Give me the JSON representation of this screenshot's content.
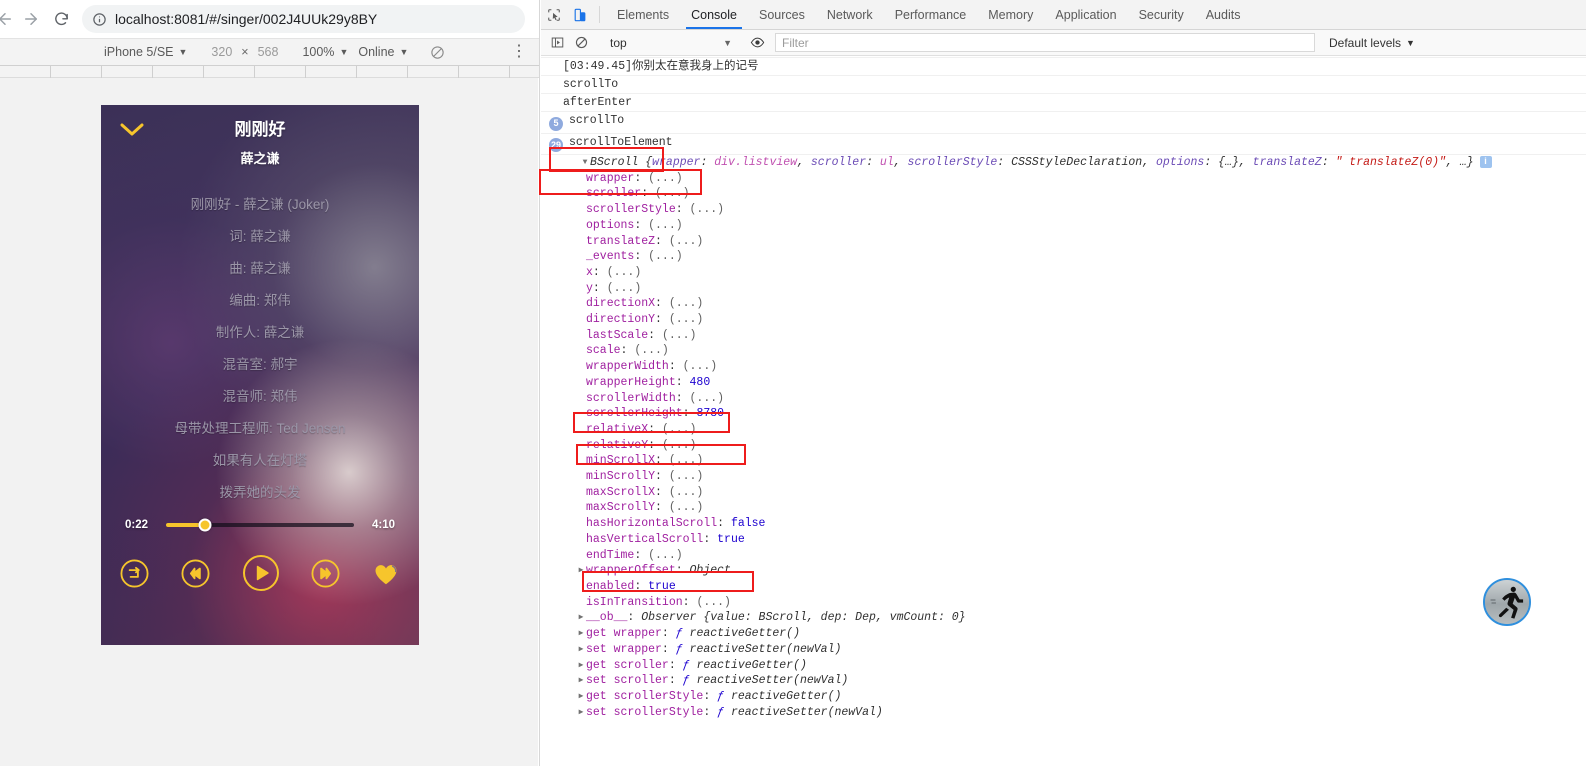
{
  "browser": {
    "back_icon": "back-arrow-icon",
    "forward_icon": "forward-arrow-icon",
    "reload_icon": "reload-icon",
    "site_info_icon": "info-circle-icon",
    "url": "localhost:8081/#/singer/002J4UUk29y8BY"
  },
  "device_toolbar": {
    "device": "iPhone 5/SE",
    "width": "320",
    "times": "×",
    "height": "568",
    "zoom": "100%",
    "throttling": "Online",
    "rotate_icon": "rotate-icon",
    "more_icon": "more-vertical-icon"
  },
  "player": {
    "back_icon": "chevron-down-icon",
    "title": "刚刚好",
    "artist": "薛之谦",
    "lyrics": [
      "刚刚好 - 薛之谦 (Joker)",
      "词: 薛之谦",
      "曲: 薛之谦",
      "编曲: 郑伟",
      "制作人: 薛之谦",
      "混音室: 郝宇",
      "混音师: 郑伟",
      "母带处理工程师: Ted Jensen",
      "如果有人在灯塔",
      "拨弄她的头发"
    ],
    "current_time": "0:22",
    "total_time": "4:10",
    "progress_percent": 21,
    "accent_color": "#f6c52c",
    "controls": [
      {
        "name": "loop-mode-button",
        "icon": "loop-sequence-icon"
      },
      {
        "name": "previous-button",
        "icon": "rewind-icon"
      },
      {
        "name": "play-pause-button",
        "icon": "play-icon"
      },
      {
        "name": "next-button",
        "icon": "fast-forward-icon"
      },
      {
        "name": "favorite-button",
        "icon": "heart-icon"
      }
    ]
  },
  "devtools": {
    "inspect_icon": "inspect-element-icon",
    "device_toggle_icon": "device-toolbar-icon",
    "tabs": [
      "Elements",
      "Console",
      "Sources",
      "Network",
      "Performance",
      "Memory",
      "Application",
      "Security",
      "Audits"
    ],
    "selected_tab": "Console",
    "filterbar": {
      "sidebar_icon": "console-sidebar-icon",
      "clear_icon": "clear-console-icon",
      "context": "top",
      "eye_icon": "live-expression-icon",
      "filter_placeholder": "Filter",
      "levels": "Default levels"
    },
    "messages": [
      {
        "text": "[03:49.45]你别太在意我身上的记号",
        "count": null
      },
      {
        "text": "scrollTo",
        "count": null
      },
      {
        "text": "afterEnter",
        "count": null
      },
      {
        "text": "scrollTo",
        "count": "5"
      },
      {
        "text": "scrollToElement",
        "count": "29"
      }
    ],
    "object_header": {
      "arrow": "▼",
      "ctor": "BScroll",
      "preview_parts": [
        {
          "key": "wrapper",
          "val": "div.listview",
          "style": "cls"
        },
        {
          "key": "scroller",
          "val": "ul",
          "style": "cls"
        },
        {
          "key": "scrollerStyle",
          "val": "CSSStyleDeclaration",
          "style": "typ"
        },
        {
          "key": "options",
          "val": "{…}",
          "style": "typ"
        },
        {
          "key": "translateZ",
          "val": "\" translateZ(0)\"",
          "style": "str"
        }
      ],
      "tail": ", …}",
      "info_badge": "i"
    },
    "properties": [
      {
        "key": "wrapper",
        "value": "(...)",
        "kind": "ellipsis"
      },
      {
        "key": "scroller",
        "value": "(...)",
        "kind": "ellipsis"
      },
      {
        "key": "scrollerStyle",
        "value": "(...)",
        "kind": "ellipsis"
      },
      {
        "key": "options",
        "value": "(...)",
        "kind": "ellipsis"
      },
      {
        "key": "translateZ",
        "value": "(...)",
        "kind": "ellipsis"
      },
      {
        "key": "_events",
        "value": "(...)",
        "kind": "ellipsis"
      },
      {
        "key": "x",
        "value": "(...)",
        "kind": "ellipsis"
      },
      {
        "key": "y",
        "value": "(...)",
        "kind": "ellipsis"
      },
      {
        "key": "directionX",
        "value": "(...)",
        "kind": "ellipsis"
      },
      {
        "key": "directionY",
        "value": "(...)",
        "kind": "ellipsis"
      },
      {
        "key": "lastScale",
        "value": "(...)",
        "kind": "ellipsis"
      },
      {
        "key": "scale",
        "value": "(...)",
        "kind": "ellipsis"
      },
      {
        "key": "wrapperWidth",
        "value": "(...)",
        "kind": "ellipsis"
      },
      {
        "key": "wrapperHeight",
        "value": "480",
        "kind": "number"
      },
      {
        "key": "scrollerWidth",
        "value": "(...)",
        "kind": "ellipsis"
      },
      {
        "key": "scrollerHeight",
        "value": "8780",
        "kind": "number"
      },
      {
        "key": "relativeX",
        "value": "(...)",
        "kind": "ellipsis"
      },
      {
        "key": "relativeY",
        "value": "(...)",
        "kind": "ellipsis"
      },
      {
        "key": "minScrollX",
        "value": "(...)",
        "kind": "ellipsis"
      },
      {
        "key": "minScrollY",
        "value": "(...)",
        "kind": "ellipsis"
      },
      {
        "key": "maxScrollX",
        "value": "(...)",
        "kind": "ellipsis"
      },
      {
        "key": "maxScrollY",
        "value": "(...)",
        "kind": "ellipsis"
      },
      {
        "key": "hasHorizontalScroll",
        "value": "false",
        "kind": "bool"
      },
      {
        "key": "hasVerticalScroll",
        "value": "true",
        "kind": "bool"
      },
      {
        "key": "endTime",
        "value": "(...)",
        "kind": "ellipsis"
      }
    ],
    "tail_rows": [
      {
        "arrow": "▶",
        "key": "wrapperOffset",
        "value": "Object",
        "kind": "plain"
      },
      {
        "arrow": "",
        "key": "enabled",
        "value": "true",
        "kind": "bool"
      },
      {
        "arrow": "",
        "key": "isInTransition",
        "value": "(...)",
        "kind": "ellipsis"
      },
      {
        "arrow": "▶",
        "key": "__ob__",
        "value": "Observer {value: BScroll, dep: Dep, vmCount: 0}",
        "kind": "observer"
      }
    ],
    "accessors": [
      {
        "arrow": "▶",
        "prefix": "get",
        "key": "wrapper",
        "fn": "reactiveGetter()"
      },
      {
        "arrow": "▶",
        "prefix": "set",
        "key": "wrapper",
        "fn": "reactiveSetter(newVal)"
      },
      {
        "arrow": "▶",
        "prefix": "get",
        "key": "scroller",
        "fn": "reactiveGetter()"
      },
      {
        "arrow": "▶",
        "prefix": "set",
        "key": "scroller",
        "fn": "reactiveSetter(newVal)"
      },
      {
        "arrow": "▶",
        "prefix": "get",
        "key": "scrollerStyle",
        "fn": "reactiveGetter()"
      },
      {
        "arrow": "▶",
        "prefix": "set",
        "key": "scrollerStyle",
        "fn": "reactiveSetter(newVal)"
      }
    ],
    "annotation_color": "#ee1c1c"
  },
  "runner": {
    "icon": "runner-avatar-icon"
  }
}
